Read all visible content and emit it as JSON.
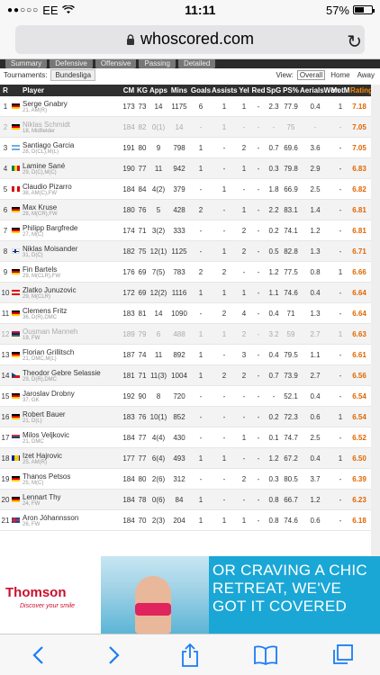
{
  "status_bar": {
    "carrier": "EE",
    "time": "11:11",
    "battery": "57%",
    "battery_level": 0.57
  },
  "browser": {
    "url": "whoscored.com"
  },
  "page": {
    "tabs": [
      "Summary",
      "Defensive",
      "Offensive",
      "Passing",
      "Detailed"
    ],
    "tournaments_label": "Tournaments:",
    "tournament_selected": "Bundesliga",
    "view_label": "View:",
    "view_options": [
      "Overall",
      "Home",
      "Away"
    ],
    "view_selected": "Overall"
  },
  "table": {
    "headers": {
      "r": "R",
      "player": "Player",
      "cm": "CM",
      "kg": "KG",
      "apps": "Apps",
      "mins": "Mins",
      "goals": "Goals",
      "assists": "Assists",
      "yel": "Yel",
      "red": "Red",
      "spg": "SpG",
      "ps": "PS%",
      "aerials": "AerialsWon",
      "motm": "MotM",
      "rating": "Rating"
    },
    "rows": [
      {
        "r": "1",
        "flag": "de",
        "name": "Serge Gnabry",
        "sub": "21, AM(R)",
        "cm": "173",
        "kg": "73",
        "apps": "14",
        "mins": "1175",
        "goals": "6",
        "assists": "1",
        "yel": "1",
        "red": "-",
        "spg": "2.3",
        "ps": "77.9",
        "aer": "0.4",
        "motm": "1",
        "rating": "7.18",
        "dim": false
      },
      {
        "r": "2",
        "flag": "de",
        "name": "Niklas Schmidt",
        "sub": "18, Midfielder",
        "cm": "184",
        "kg": "82",
        "apps": "0(1)",
        "mins": "14",
        "goals": "-",
        "assists": "1",
        "yel": "-",
        "red": "-",
        "spg": "-",
        "ps": "75",
        "aer": "-",
        "motm": "-",
        "rating": "7.05",
        "dim": true
      },
      {
        "r": "3",
        "flag": "ar",
        "name": "Santiago Garcia",
        "sub": "28, D(CL),M(L)",
        "cm": "191",
        "kg": "80",
        "apps": "9",
        "mins": "798",
        "goals": "1",
        "assists": "-",
        "yel": "2",
        "red": "-",
        "spg": "0.7",
        "ps": "69.6",
        "aer": "3.6",
        "motm": "-",
        "rating": "7.05",
        "dim": false
      },
      {
        "r": "4",
        "flag": "sn",
        "name": "Lamine Sané",
        "sub": "29, D(C),M(C)",
        "cm": "190",
        "kg": "77",
        "apps": "11",
        "mins": "942",
        "goals": "1",
        "assists": "-",
        "yel": "1",
        "red": "-",
        "spg": "0.3",
        "ps": "79.8",
        "aer": "2.9",
        "motm": "-",
        "rating": "6.83",
        "dim": false
      },
      {
        "r": "5",
        "flag": "pe",
        "name": "Claudio Pizarro",
        "sub": "38, AM(C),FW",
        "cm": "184",
        "kg": "84",
        "apps": "4(2)",
        "mins": "379",
        "goals": "-",
        "assists": "1",
        "yel": "-",
        "red": "-",
        "spg": "1.8",
        "ps": "66.9",
        "aer": "2.5",
        "motm": "-",
        "rating": "6.82",
        "dim": false
      },
      {
        "r": "6",
        "flag": "de",
        "name": "Max Kruse",
        "sub": "28, M(CR),FW",
        "cm": "180",
        "kg": "76",
        "apps": "5",
        "mins": "428",
        "goals": "2",
        "assists": "-",
        "yel": "1",
        "red": "-",
        "spg": "2.2",
        "ps": "83.1",
        "aer": "1.4",
        "motm": "-",
        "rating": "6.81",
        "dim": false
      },
      {
        "r": "7",
        "flag": "de",
        "name": "Philipp Bargfrede",
        "sub": "27, M(C)",
        "cm": "174",
        "kg": "71",
        "apps": "3(2)",
        "mins": "333",
        "goals": "-",
        "assists": "-",
        "yel": "2",
        "red": "-",
        "spg": "0.2",
        "ps": "74.1",
        "aer": "1.2",
        "motm": "-",
        "rating": "6.81",
        "dim": false
      },
      {
        "r": "8",
        "flag": "fi",
        "name": "Niklas Moisander",
        "sub": "31, D(C)",
        "cm": "182",
        "kg": "75",
        "apps": "12(1)",
        "mins": "1125",
        "goals": "-",
        "assists": "1",
        "yel": "2",
        "red": "-",
        "spg": "0.5",
        "ps": "82.8",
        "aer": "1.3",
        "motm": "-",
        "rating": "6.71",
        "dim": false
      },
      {
        "r": "9",
        "flag": "de",
        "name": "Fin Bartels",
        "sub": "29, M(CLR),FW",
        "cm": "176",
        "kg": "69",
        "apps": "7(5)",
        "mins": "783",
        "goals": "2",
        "assists": "2",
        "yel": "-",
        "red": "-",
        "spg": "1.2",
        "ps": "77.5",
        "aer": "0.8",
        "motm": "1",
        "rating": "6.66",
        "dim": false
      },
      {
        "r": "10",
        "flag": "at",
        "name": "Zlatko Junuzovic",
        "sub": "29, M(CLR)",
        "cm": "172",
        "kg": "69",
        "apps": "12(2)",
        "mins": "1116",
        "goals": "1",
        "assists": "1",
        "yel": "1",
        "red": "-",
        "spg": "1.1",
        "ps": "74.6",
        "aer": "0.4",
        "motm": "-",
        "rating": "6.64",
        "dim": false
      },
      {
        "r": "11",
        "flag": "de",
        "name": "Clemens Fritz",
        "sub": "36, D(R),DMC",
        "cm": "183",
        "kg": "81",
        "apps": "14",
        "mins": "1090",
        "goals": "-",
        "assists": "2",
        "yel": "4",
        "red": "-",
        "spg": "0.4",
        "ps": "71",
        "aer": "1.3",
        "motm": "-",
        "rating": "6.64",
        "dim": false
      },
      {
        "r": "12",
        "flag": "gm",
        "name": "Ousman Manneh",
        "sub": "19, FW",
        "cm": "189",
        "kg": "79",
        "apps": "6",
        "mins": "488",
        "goals": "1",
        "assists": "1",
        "yel": "2",
        "red": "-",
        "spg": "3.2",
        "ps": "59",
        "aer": "2.7",
        "motm": "1",
        "rating": "6.63",
        "dim": true
      },
      {
        "r": "13",
        "flag": "de",
        "name": "Florian Grillitsch",
        "sub": "21, DMC,M(L)",
        "cm": "187",
        "kg": "74",
        "apps": "11",
        "mins": "892",
        "goals": "1",
        "assists": "-",
        "yel": "3",
        "red": "-",
        "spg": "0.4",
        "ps": "79.5",
        "aer": "1.1",
        "motm": "-",
        "rating": "6.61",
        "dim": false
      },
      {
        "r": "14",
        "flag": "cz",
        "name": "Theodor Gebre Selassie",
        "sub": "29, D(R),DMC",
        "cm": "181",
        "kg": "71",
        "apps": "11(3)",
        "mins": "1004",
        "goals": "1",
        "assists": "2",
        "yel": "2",
        "red": "-",
        "spg": "0.7",
        "ps": "73.9",
        "aer": "2.7",
        "motm": "-",
        "rating": "6.56",
        "dim": false
      },
      {
        "r": "15",
        "flag": "de",
        "name": "Jaroslav Drobny",
        "sub": "37, GK",
        "cm": "192",
        "kg": "90",
        "apps": "8",
        "mins": "720",
        "goals": "-",
        "assists": "-",
        "yel": "-",
        "red": "-",
        "spg": "-",
        "ps": "52.1",
        "aer": "0.4",
        "motm": "-",
        "rating": "6.54",
        "dim": false
      },
      {
        "r": "16",
        "flag": "de",
        "name": "Robert Bauer",
        "sub": "21, D(L)",
        "cm": "183",
        "kg": "76",
        "apps": "10(1)",
        "mins": "852",
        "goals": "-",
        "assists": "-",
        "yel": "-",
        "red": "-",
        "spg": "0.2",
        "ps": "72.3",
        "aer": "0.6",
        "motm": "1",
        "rating": "6.54",
        "dim": false
      },
      {
        "r": "17",
        "flag": "rs",
        "name": "Milos Veljkovic",
        "sub": "21, DMC",
        "cm": "184",
        "kg": "77",
        "apps": "4(4)",
        "mins": "430",
        "goals": "-",
        "assists": "-",
        "yel": "1",
        "red": "-",
        "spg": "0.1",
        "ps": "74.7",
        "aer": "2.5",
        "motm": "-",
        "rating": "6.52",
        "dim": false
      },
      {
        "r": "18",
        "flag": "ba",
        "name": "Izet Hajrovic",
        "sub": "25, AM(R)",
        "cm": "177",
        "kg": "77",
        "apps": "6(4)",
        "mins": "493",
        "goals": "1",
        "assists": "1",
        "yel": "-",
        "red": "-",
        "spg": "1.2",
        "ps": "67.2",
        "aer": "0.4",
        "motm": "1",
        "rating": "6.50",
        "dim": false
      },
      {
        "r": "19",
        "flag": "de",
        "name": "Thanos Petsos",
        "sub": "25, M(C)",
        "cm": "184",
        "kg": "80",
        "apps": "2(6)",
        "mins": "312",
        "goals": "-",
        "assists": "-",
        "yel": "2",
        "red": "-",
        "spg": "0.3",
        "ps": "80.5",
        "aer": "3.7",
        "motm": "-",
        "rating": "6.39",
        "dim": false
      },
      {
        "r": "20",
        "flag": "de",
        "name": "Lennart Thy",
        "sub": "24, FW",
        "cm": "184",
        "kg": "78",
        "apps": "0(6)",
        "mins": "84",
        "goals": "1",
        "assists": "-",
        "yel": "-",
        "red": "-",
        "spg": "0.8",
        "ps": "66.7",
        "aer": "1.2",
        "motm": "-",
        "rating": "6.23",
        "dim": false
      },
      {
        "r": "21",
        "flag": "is",
        "name": "Aron Jóhannsson",
        "sub": "26, FW",
        "cm": "184",
        "kg": "70",
        "apps": "2(3)",
        "mins": "204",
        "goals": "1",
        "assists": "1",
        "yel": "1",
        "red": "-",
        "spg": "0.8",
        "ps": "74.6",
        "aer": "0.6",
        "motm": "-",
        "rating": "6.18",
        "dim": false
      }
    ]
  },
  "banner": {
    "brand": "Thomson",
    "tagline": "Discover your smile",
    "text": "OR CRAVING A CHIC RETREAT, WE'VE GOT IT COVERED"
  },
  "colors": {
    "rating": "#e06600",
    "header_bg": "#2f2f2f",
    "banner_blue": "#1aa7d6",
    "ios_blue": "#1a7cf5"
  }
}
